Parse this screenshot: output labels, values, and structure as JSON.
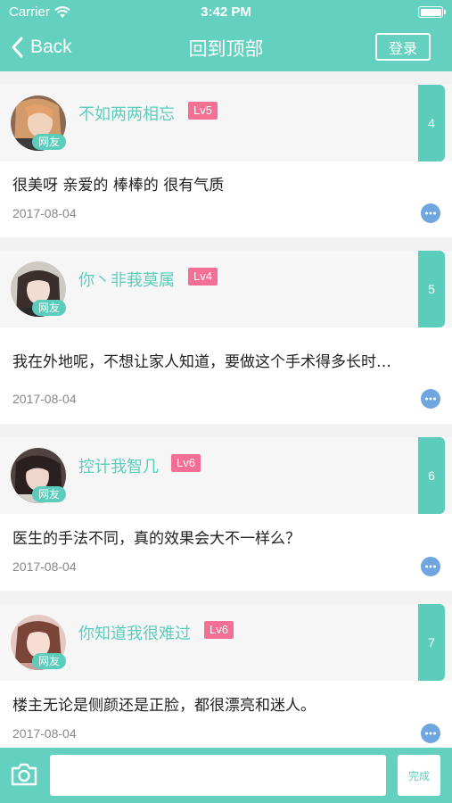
{
  "status_bar": {
    "carrier": "Carrier",
    "time": "3:42 PM"
  },
  "nav": {
    "back_label": "Back",
    "title": "回到顶部",
    "login_label": "登录"
  },
  "colors": {
    "accent": "#63d0c0",
    "level_badge": "#f36f94",
    "reply_icon": "#6fa6e0"
  },
  "comments": [
    {
      "username": "不如两两相忘",
      "level": "Lv5",
      "tag": "网友",
      "floor": "4",
      "text": "很美呀  亲爱的  棒棒的  很有气质",
      "date": "2017-08-04"
    },
    {
      "username": "你丶非莪莫属",
      "level": "Lv4",
      "tag": "网友",
      "floor": "5",
      "text": "我在外地呢，不想让家人知道，要做这个手术得多长时…",
      "date": "2017-08-04"
    },
    {
      "username": "控计我智几",
      "level": "Lv6",
      "tag": "网友",
      "floor": "6",
      "text": "医生的手法不同，真的效果会大不一样么？",
      "date": "2017-08-04"
    },
    {
      "username": "你知道我很难过",
      "level": "Lv6",
      "tag": "网友",
      "floor": "7",
      "text": "楼主无论是侧颜还是正脸，都很漂亮和迷人。",
      "date": "2017-08-04"
    }
  ],
  "bottom_bar": {
    "input_value": "",
    "input_placeholder": "",
    "done_label": "完成"
  }
}
